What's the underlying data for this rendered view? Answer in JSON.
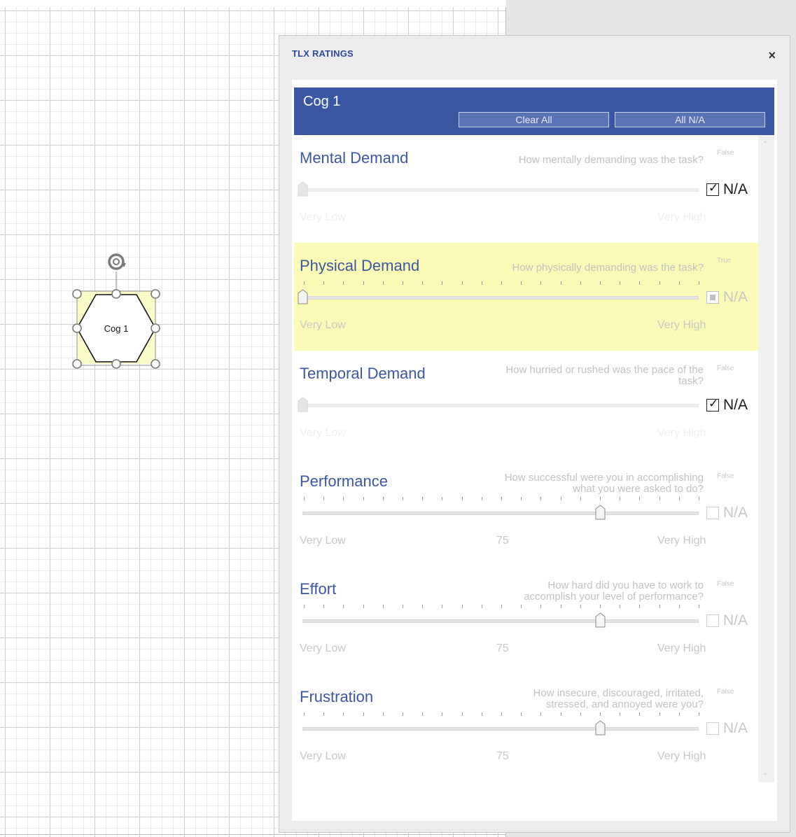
{
  "canvas": {
    "shape_label": "Cog 1"
  },
  "panel": {
    "title": "TLX RATINGS",
    "close_glyph": "×",
    "cog_name": "Cog 1",
    "clear_all_label": "Clear All",
    "all_na_label": "All N/A",
    "scroll_up_glyph": "⌃",
    "scroll_down_glyph": "⌄",
    "colors": {
      "accent": "#3b57a3",
      "highlight": "#fafab6"
    },
    "rows": [
      {
        "name": "Mental Demand",
        "question": "How mentally demanding was the task?",
        "state": "False",
        "low": "Very Low",
        "high": "Very High",
        "value": "",
        "slider_percent": 0,
        "na_label": "N/A",
        "na_state": "checked",
        "highlighted": false
      },
      {
        "name": "Physical Demand",
        "question": "How physically demanding was the task?",
        "state": "True",
        "low": "Very Low",
        "high": "Very High",
        "value": "",
        "slider_percent": 0,
        "na_label": "N/A",
        "na_state": "indeterminate",
        "highlighted": true
      },
      {
        "name": "Temporal Demand",
        "question": "How hurried or rushed was the pace of the task?",
        "state": "False",
        "low": "Very Low",
        "high": "Very High",
        "value": "",
        "slider_percent": 0,
        "na_label": "N/A",
        "na_state": "checked",
        "highlighted": false
      },
      {
        "name": "Performance",
        "question": "How successful were you in accomplishing what you were asked to do?",
        "state": "False",
        "low": "Very Low",
        "high": "Very High",
        "value": "75",
        "slider_percent": 75,
        "na_label": "N/A",
        "na_state": "unchecked",
        "highlighted": false
      },
      {
        "name": "Effort",
        "question": "How hard did you have to work to accomplish your level of performance?",
        "state": "False",
        "low": "Very Low",
        "high": "Very High",
        "value": "75",
        "slider_percent": 75,
        "na_label": "N/A",
        "na_state": "unchecked",
        "highlighted": false
      },
      {
        "name": "Frustration",
        "question": "How insecure, discouraged, irritated, stressed, and annoyed were you?",
        "state": "False",
        "low": "Very Low",
        "high": "Very High",
        "value": "75",
        "slider_percent": 75,
        "na_label": "N/A",
        "na_state": "unchecked",
        "highlighted": false
      }
    ]
  }
}
